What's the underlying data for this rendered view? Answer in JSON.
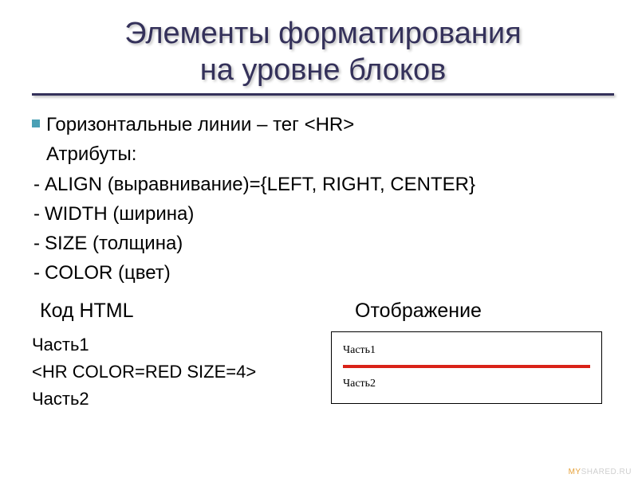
{
  "title_line1": "Элементы форматирования",
  "title_line2": "на уровне блоков",
  "bullet1_prefix": "Горизонтальные линии – тег ",
  "bullet1_tag": "<HR>",
  "attrs_label": "Атрибуты:",
  "attr_align": "ALIGN (выравнивание)={LEFT, RIGHT, CENTER}",
  "attr_width": "WIDTH (ширина)",
  "attr_size": "SIZE (толщина)",
  "attr_color": "COLOR (цвет)",
  "col_code_head": "Код HTML",
  "col_display_head": "Отображение",
  "code_line1": "Часть1",
  "code_line2": "<HR COLOR=RED SIZE=4>",
  "code_line3": "Часть2",
  "render_line1": "Часть1",
  "render_line2": "Часть2",
  "watermark_my": "MY",
  "watermark_rest": "SHARED.RU"
}
